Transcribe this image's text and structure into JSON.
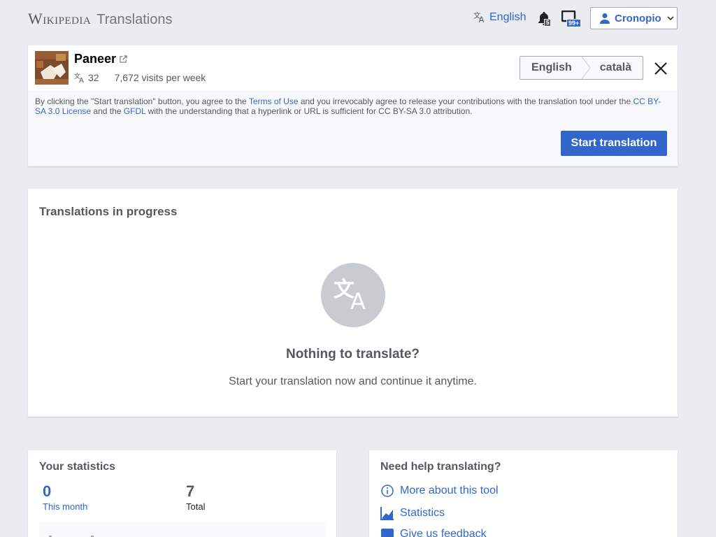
{
  "header": {
    "logo_word": "Wikipedia",
    "logo_sub": "Translations",
    "interface_language": "English",
    "alerts_count": "5",
    "notices_count": "99+",
    "username": "Cronopio"
  },
  "source": {
    "title": "Paneer",
    "languages_count": "32",
    "visits": "7,672 visits per week",
    "source_language": "English",
    "target_language": "català",
    "legal": {
      "part1": "By clicking the \"Start translation\" button, you agree to the ",
      "terms_link": "Terms of Use",
      "part2": " and you irrevocably agree to release your contributions with the translation tool under the ",
      "license_link": "CC BY-SA 3.0 License",
      "part3": " and the ",
      "gfdl_link": "GFDL",
      "part4": " with the understanding that a hyperlink or URL is sufficient for CC BY-SA 3.0 attribution."
    },
    "start_button": "Start translation"
  },
  "in_progress": {
    "title": "Translations in progress",
    "empty_title": "Nothing to translate?",
    "empty_subtitle": "Start your translation now and continue it anytime."
  },
  "stats": {
    "title": "Your statistics",
    "this_month_value": "0",
    "this_month_label": "This month",
    "total_value": "7",
    "total_label": "Total"
  },
  "help": {
    "title": "Need help translating?",
    "items": [
      {
        "label": "More about this tool",
        "icon": "info-icon"
      },
      {
        "label": "Statistics",
        "icon": "chart-icon"
      },
      {
        "label": "Give us feedback",
        "icon": "feedback-icon"
      }
    ]
  },
  "colors": {
    "accent": "#3366cc",
    "background": "#eaecf0",
    "text_muted": "#54595d"
  }
}
